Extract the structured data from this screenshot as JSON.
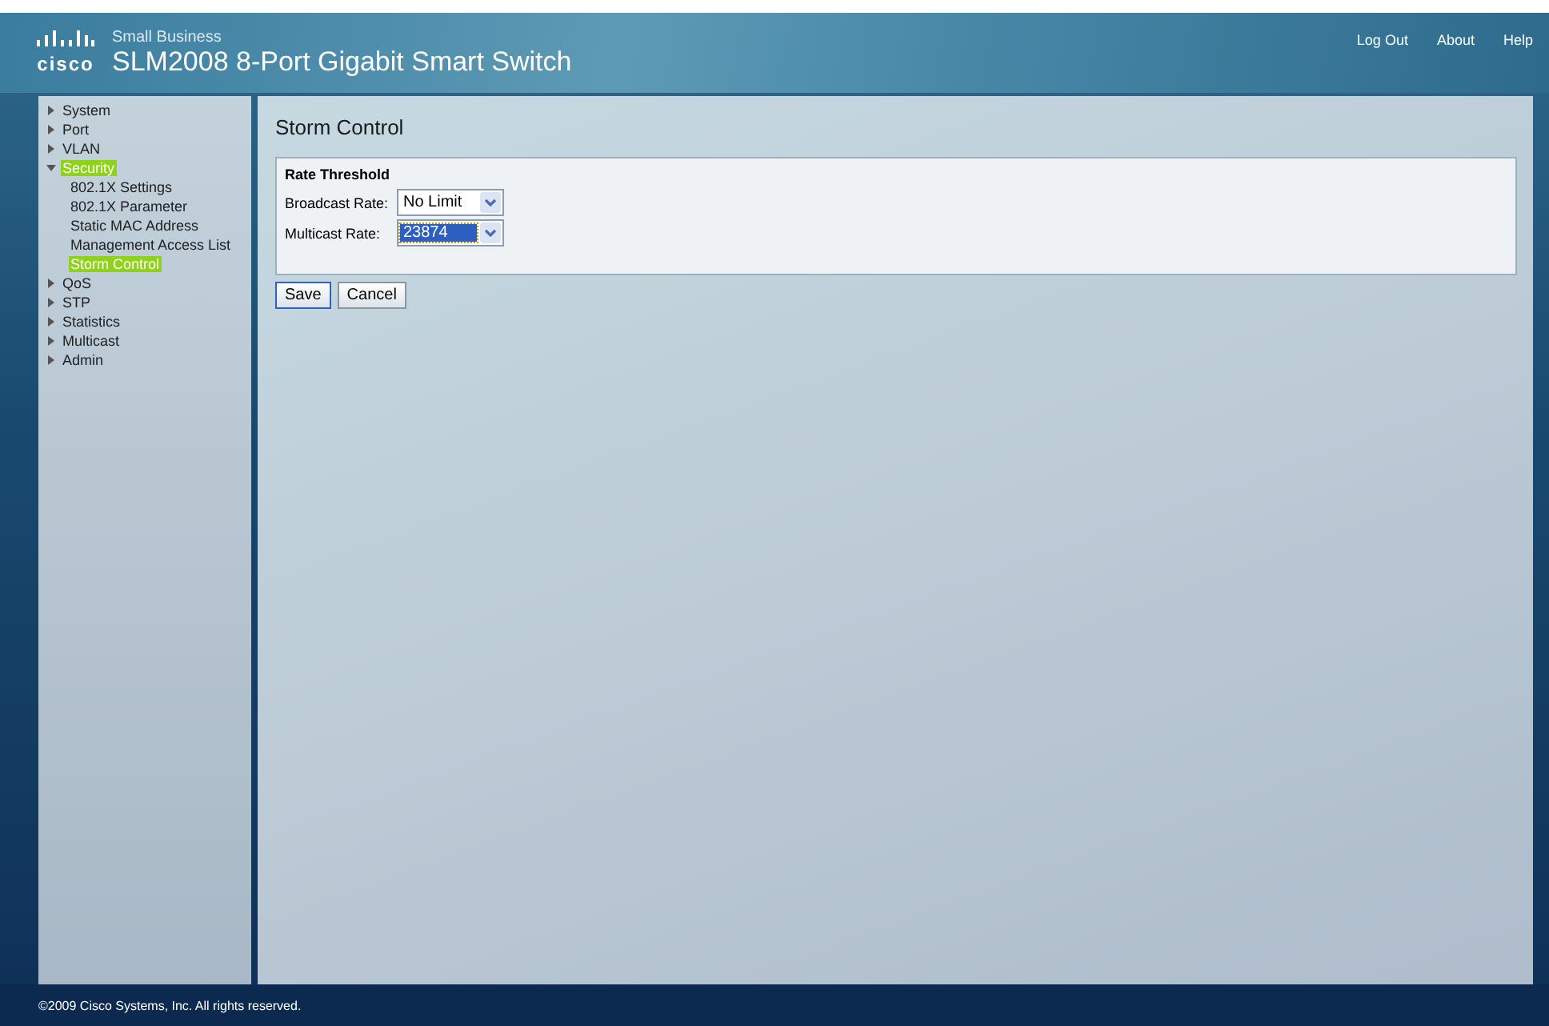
{
  "header": {
    "logo_text": "cisco",
    "subtitle": "Small Business",
    "title": "SLM2008 8-Port Gigabit Smart Switch",
    "links": [
      "Log Out",
      "About",
      "Help"
    ]
  },
  "sidebar": {
    "items": [
      {
        "label": "System",
        "expanded": false,
        "selected": false
      },
      {
        "label": "Port",
        "expanded": false,
        "selected": false
      },
      {
        "label": "VLAN",
        "expanded": false,
        "selected": false
      },
      {
        "label": "Security",
        "expanded": true,
        "selected": true,
        "children": [
          {
            "label": "802.1X Settings",
            "selected": false
          },
          {
            "label": "802.1X Parameter",
            "selected": false
          },
          {
            "label": "Static MAC Address",
            "selected": false
          },
          {
            "label": "Management Access List",
            "selected": false
          },
          {
            "label": "Storm Control",
            "selected": true
          }
        ]
      },
      {
        "label": "QoS",
        "expanded": false,
        "selected": false
      },
      {
        "label": "STP",
        "expanded": false,
        "selected": false
      },
      {
        "label": "Statistics",
        "expanded": false,
        "selected": false
      },
      {
        "label": "Multicast",
        "expanded": false,
        "selected": false
      },
      {
        "label": "Admin",
        "expanded": false,
        "selected": false
      }
    ]
  },
  "page": {
    "title": "Storm Control",
    "section": "Rate Threshold",
    "fields": [
      {
        "label": "Broadcast Rate:",
        "value": "No Limit",
        "focused": false
      },
      {
        "label": "Multicast Rate:",
        "value": "23874",
        "focused": true
      }
    ],
    "buttons": [
      {
        "label": "Save",
        "focused": true
      },
      {
        "label": "Cancel",
        "focused": false
      }
    ]
  },
  "footer": "©2009 Cisco Systems, Inc. All rights reserved."
}
